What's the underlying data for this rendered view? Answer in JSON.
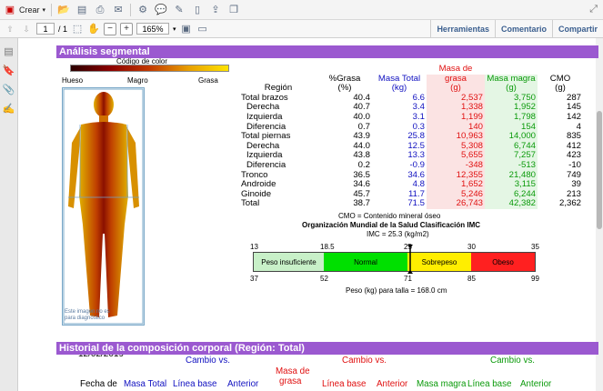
{
  "toolbar": {
    "create_label": "Crear",
    "page_current": "1",
    "page_total": "/ 1",
    "zoom": "165%",
    "links": [
      "Herramientas",
      "Comentario",
      "Compartir"
    ]
  },
  "segmental": {
    "title": "Análisis segmental",
    "color_code_label": "Código de color",
    "legend_left": "Hueso",
    "legend_mid": "Magro",
    "legend_right": "Grasa",
    "image_caption": "Este imagen no es para diagnóstico",
    "date": "12/02/2019",
    "headers": {
      "region": "Región",
      "pct_fat": "%Grasa",
      "pct_fat_unit": "(%)",
      "total_mass": "Masa Total",
      "total_mass_unit": "(kg)",
      "fat_mass_a": "Masa de",
      "fat_mass_b": "grasa",
      "fat_mass_unit": "(g)",
      "lean_mass": "Masa magra",
      "lean_mass_unit": "(g)",
      "cmo": "CMO",
      "cmo_unit": "(g)"
    },
    "rows": [
      {
        "region": "Total brazos",
        "pct": "40.4",
        "total": "6.6",
        "fat": "2,537",
        "lean": "3,750",
        "cmo": "287",
        "indent": false
      },
      {
        "region": "Derecha",
        "pct": "40.7",
        "total": "3.4",
        "fat": "1,338",
        "lean": "1,952",
        "cmo": "145",
        "indent": true
      },
      {
        "region": "Izquierda",
        "pct": "40.0",
        "total": "3.1",
        "fat": "1,199",
        "lean": "1,798",
        "cmo": "142",
        "indent": true
      },
      {
        "region": "Diferencia",
        "pct": "0.7",
        "total": "0.3",
        "fat": "140",
        "lean": "154",
        "cmo": "4",
        "indent": true
      },
      {
        "region": "Total piernas",
        "pct": "43.9",
        "total": "25.8",
        "fat": "10,963",
        "lean": "14,000",
        "cmo": "835",
        "indent": false
      },
      {
        "region": "Derecha",
        "pct": "44.0",
        "total": "12.5",
        "fat": "5,308",
        "lean": "6,744",
        "cmo": "412",
        "indent": true
      },
      {
        "region": "Izquierda",
        "pct": "43.8",
        "total": "13.3",
        "fat": "5,655",
        "lean": "7,257",
        "cmo": "423",
        "indent": true
      },
      {
        "region": "Diferencia",
        "pct": "0.2",
        "total": "-0.9",
        "fat": "-348",
        "lean": "-513",
        "cmo": "-10",
        "indent": true
      },
      {
        "region": "Tronco",
        "pct": "36.5",
        "total": "34.6",
        "fat": "12,355",
        "lean": "21,480",
        "cmo": "749",
        "indent": false
      },
      {
        "region": "Androide",
        "pct": "34.6",
        "total": "4.8",
        "fat": "1,652",
        "lean": "3,115",
        "cmo": "39",
        "indent": false
      },
      {
        "region": "Ginoide",
        "pct": "45.7",
        "total": "11.7",
        "fat": "5,246",
        "lean": "6,244",
        "cmo": "213",
        "indent": false
      },
      {
        "region": "Total",
        "pct": "38.7",
        "total": "71.5",
        "fat": "26,743",
        "lean": "42,382",
        "cmo": "2,362",
        "indent": false
      }
    ],
    "cmo_note": "CMO = Contenido mineral óseo",
    "oms_title": "Organización Mundial de la Salud Clasificación IMC",
    "imc_value": "IMC = 25.3 (kg/m2)",
    "bmi_scale": {
      "top_ticks": [
        "13",
        "18.5",
        "25",
        "30",
        "35"
      ],
      "bottom_ticks": [
        "37",
        "52",
        "71",
        "85",
        "99"
      ],
      "segments": [
        "Peso insuficiente",
        "Normal",
        "Sobrepeso",
        "Obeso"
      ],
      "colors": [
        "#c8f0c8",
        "#00e000",
        "#ffee00",
        "#ff2020"
      ],
      "marker_value": 25.3
    },
    "weight_note": "Peso (kg) para talla = 168.0 cm"
  },
  "history": {
    "title": "Historial de la composición corporal (Región: Total)",
    "headers": {
      "date": "Fecha de",
      "total_mass": "Masa Total",
      "baseline": "Línea base",
      "previous": "Anterior",
      "fat_mass_a": "Masa de",
      "fat_mass_b": "grasa",
      "lean_mass": "Masa magra",
      "change_vs": "Cambio vs."
    }
  }
}
